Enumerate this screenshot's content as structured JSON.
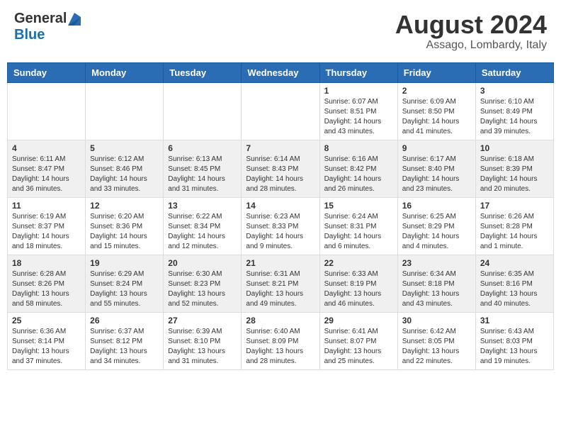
{
  "header": {
    "logo_general": "General",
    "logo_blue": "Blue",
    "month_year": "August 2024",
    "location": "Assago, Lombardy, Italy"
  },
  "weekdays": [
    "Sunday",
    "Monday",
    "Tuesday",
    "Wednesday",
    "Thursday",
    "Friday",
    "Saturday"
  ],
  "weeks": [
    [
      {
        "day": "",
        "info": ""
      },
      {
        "day": "",
        "info": ""
      },
      {
        "day": "",
        "info": ""
      },
      {
        "day": "",
        "info": ""
      },
      {
        "day": "1",
        "info": "Sunrise: 6:07 AM\nSunset: 8:51 PM\nDaylight: 14 hours\nand 43 minutes."
      },
      {
        "day": "2",
        "info": "Sunrise: 6:09 AM\nSunset: 8:50 PM\nDaylight: 14 hours\nand 41 minutes."
      },
      {
        "day": "3",
        "info": "Sunrise: 6:10 AM\nSunset: 8:49 PM\nDaylight: 14 hours\nand 39 minutes."
      }
    ],
    [
      {
        "day": "4",
        "info": "Sunrise: 6:11 AM\nSunset: 8:47 PM\nDaylight: 14 hours\nand 36 minutes."
      },
      {
        "day": "5",
        "info": "Sunrise: 6:12 AM\nSunset: 8:46 PM\nDaylight: 14 hours\nand 33 minutes."
      },
      {
        "day": "6",
        "info": "Sunrise: 6:13 AM\nSunset: 8:45 PM\nDaylight: 14 hours\nand 31 minutes."
      },
      {
        "day": "7",
        "info": "Sunrise: 6:14 AM\nSunset: 8:43 PM\nDaylight: 14 hours\nand 28 minutes."
      },
      {
        "day": "8",
        "info": "Sunrise: 6:16 AM\nSunset: 8:42 PM\nDaylight: 14 hours\nand 26 minutes."
      },
      {
        "day": "9",
        "info": "Sunrise: 6:17 AM\nSunset: 8:40 PM\nDaylight: 14 hours\nand 23 minutes."
      },
      {
        "day": "10",
        "info": "Sunrise: 6:18 AM\nSunset: 8:39 PM\nDaylight: 14 hours\nand 20 minutes."
      }
    ],
    [
      {
        "day": "11",
        "info": "Sunrise: 6:19 AM\nSunset: 8:37 PM\nDaylight: 14 hours\nand 18 minutes."
      },
      {
        "day": "12",
        "info": "Sunrise: 6:20 AM\nSunset: 8:36 PM\nDaylight: 14 hours\nand 15 minutes."
      },
      {
        "day": "13",
        "info": "Sunrise: 6:22 AM\nSunset: 8:34 PM\nDaylight: 14 hours\nand 12 minutes."
      },
      {
        "day": "14",
        "info": "Sunrise: 6:23 AM\nSunset: 8:33 PM\nDaylight: 14 hours\nand 9 minutes."
      },
      {
        "day": "15",
        "info": "Sunrise: 6:24 AM\nSunset: 8:31 PM\nDaylight: 14 hours\nand 6 minutes."
      },
      {
        "day": "16",
        "info": "Sunrise: 6:25 AM\nSunset: 8:29 PM\nDaylight: 14 hours\nand 4 minutes."
      },
      {
        "day": "17",
        "info": "Sunrise: 6:26 AM\nSunset: 8:28 PM\nDaylight: 14 hours\nand 1 minute."
      }
    ],
    [
      {
        "day": "18",
        "info": "Sunrise: 6:28 AM\nSunset: 8:26 PM\nDaylight: 13 hours\nand 58 minutes."
      },
      {
        "day": "19",
        "info": "Sunrise: 6:29 AM\nSunset: 8:24 PM\nDaylight: 13 hours\nand 55 minutes."
      },
      {
        "day": "20",
        "info": "Sunrise: 6:30 AM\nSunset: 8:23 PM\nDaylight: 13 hours\nand 52 minutes."
      },
      {
        "day": "21",
        "info": "Sunrise: 6:31 AM\nSunset: 8:21 PM\nDaylight: 13 hours\nand 49 minutes."
      },
      {
        "day": "22",
        "info": "Sunrise: 6:33 AM\nSunset: 8:19 PM\nDaylight: 13 hours\nand 46 minutes."
      },
      {
        "day": "23",
        "info": "Sunrise: 6:34 AM\nSunset: 8:18 PM\nDaylight: 13 hours\nand 43 minutes."
      },
      {
        "day": "24",
        "info": "Sunrise: 6:35 AM\nSunset: 8:16 PM\nDaylight: 13 hours\nand 40 minutes."
      }
    ],
    [
      {
        "day": "25",
        "info": "Sunrise: 6:36 AM\nSunset: 8:14 PM\nDaylight: 13 hours\nand 37 minutes."
      },
      {
        "day": "26",
        "info": "Sunrise: 6:37 AM\nSunset: 8:12 PM\nDaylight: 13 hours\nand 34 minutes."
      },
      {
        "day": "27",
        "info": "Sunrise: 6:39 AM\nSunset: 8:10 PM\nDaylight: 13 hours\nand 31 minutes."
      },
      {
        "day": "28",
        "info": "Sunrise: 6:40 AM\nSunset: 8:09 PM\nDaylight: 13 hours\nand 28 minutes."
      },
      {
        "day": "29",
        "info": "Sunrise: 6:41 AM\nSunset: 8:07 PM\nDaylight: 13 hours\nand 25 minutes."
      },
      {
        "day": "30",
        "info": "Sunrise: 6:42 AM\nSunset: 8:05 PM\nDaylight: 13 hours\nand 22 minutes."
      },
      {
        "day": "31",
        "info": "Sunrise: 6:43 AM\nSunset: 8:03 PM\nDaylight: 13 hours\nand 19 minutes."
      }
    ]
  ]
}
